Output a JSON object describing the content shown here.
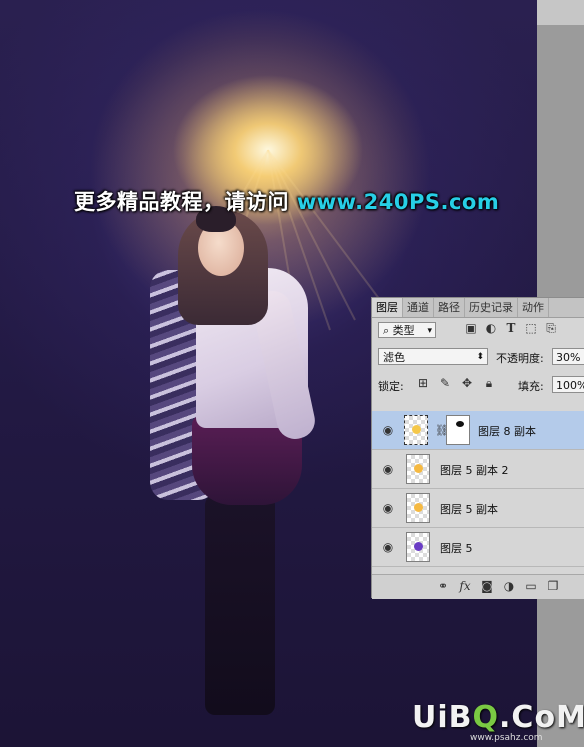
{
  "watermark_top": {
    "prefix": "更多精品教程，请访问 ",
    "url": "www.240PS.com"
  },
  "panel": {
    "tabs": [
      "图层",
      "通道",
      "路径",
      "历史记录",
      "动作"
    ],
    "active_tab": "图层",
    "filter": {
      "kind_label": "类型"
    },
    "blend_mode": "滤色",
    "opacity_label": "不透明度:",
    "opacity_value": "30%",
    "lock_label": "锁定:",
    "fill_label": "填充:",
    "fill_value": "100%",
    "layers": [
      {
        "name": "图层 8 副本",
        "selected": true,
        "has_mask": true,
        "thumb_color": "#f5c84a"
      },
      {
        "name": "图层 5 副本 2",
        "selected": false,
        "has_mask": false,
        "thumb_color": "#f5b942"
      },
      {
        "name": "图层 5 副本",
        "selected": false,
        "has_mask": false,
        "thumb_color": "#f5b942"
      },
      {
        "name": "图层 5",
        "selected": false,
        "has_mask": false,
        "thumb_color": "#6a3cc4"
      }
    ],
    "bottom_icons": [
      "link-icon",
      "fx-icon",
      "mask-icon",
      "adjustment-icon",
      "group-icon",
      "new-layer-icon"
    ]
  },
  "watermark_bottom": {
    "pre": "UiB",
    "o": "Q",
    "post": ".CoM",
    "small": "www.psahz.com"
  },
  "colors": {
    "selected_row": "#b4cbea",
    "url_cyan": "#27cfe6"
  }
}
